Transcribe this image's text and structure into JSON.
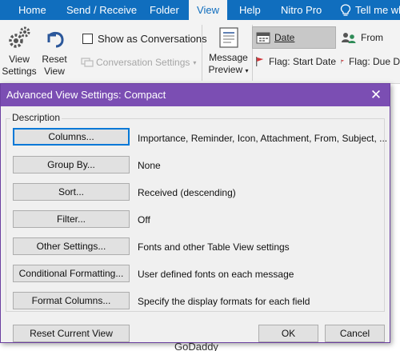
{
  "ribbon_tabs": [
    {
      "label": "Home"
    },
    {
      "label": "Send / Receive"
    },
    {
      "label": "Folder"
    },
    {
      "label": "View"
    },
    {
      "label": "Help"
    },
    {
      "label": "Nitro Pro"
    },
    {
      "label": "Tell me wh"
    }
  ],
  "active_tab": "View",
  "ribbon": {
    "view_settings_label": "View\nSettings",
    "view_settings_l1": "View",
    "view_settings_l2": "Settings",
    "reset_view_l1": "Reset",
    "reset_view_l2": "View",
    "show_as_conversations": "Show as Conversations",
    "conversation_settings": "Conversation Settings",
    "message_preview_l1": "Message",
    "message_preview_l2": "Preview",
    "arrange": [
      {
        "label": "Date",
        "icon": "calendar-icon",
        "selected": true
      },
      {
        "label": "From",
        "icon": "people-icon"
      },
      {
        "label": "Flag: Start Date",
        "icon": "red-flag-icon"
      },
      {
        "label": "Flag: Due D",
        "icon": "red-flag-icon"
      }
    ]
  },
  "dialog": {
    "title": "Advanced View Settings: Compact",
    "group_label": "Description",
    "rows": [
      {
        "button": "Columns...",
        "description": "Importance, Reminder, Icon, Attachment, From, Subject, ..."
      },
      {
        "button": "Group By...",
        "description": "None"
      },
      {
        "button": "Sort...",
        "description": "Received (descending)"
      },
      {
        "button": "Filter...",
        "description": "Off"
      },
      {
        "button": "Other Settings...",
        "description": "Fonts and other Table View settings"
      },
      {
        "button": "Conditional Formatting...",
        "description": "User defined fonts on each message"
      },
      {
        "button": "Format Columns...",
        "description": "Specify the display formats for each field"
      }
    ],
    "reset_button": "Reset Current View",
    "ok_button": "OK",
    "cancel_button": "Cancel"
  },
  "background_text": "GoDaddy",
  "colors": {
    "tab_bar": "#106ebe",
    "dialog_title": "#7b4eb3",
    "focus": "#0078d7",
    "flag": "#d13438"
  }
}
